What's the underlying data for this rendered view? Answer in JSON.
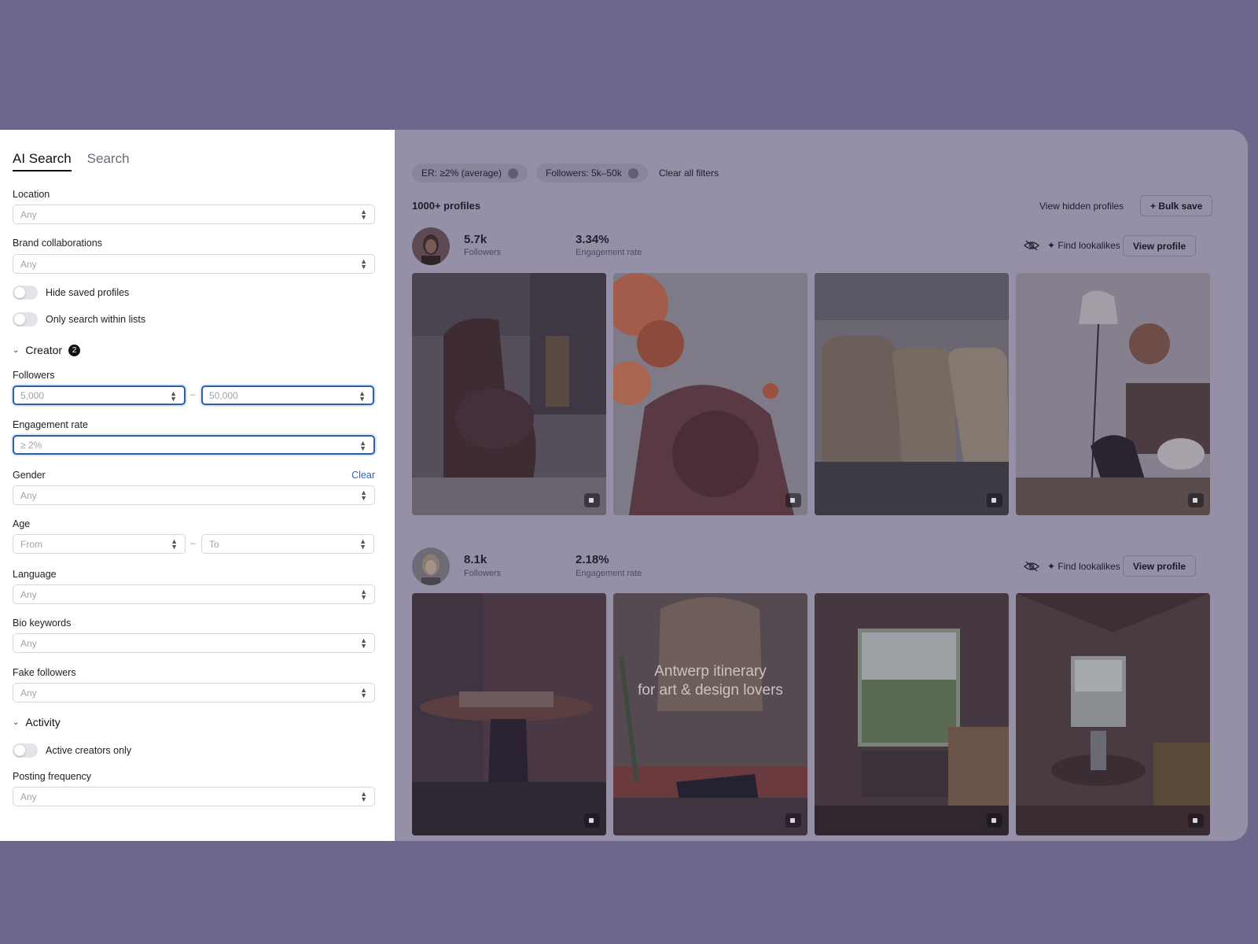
{
  "tabs": [
    {
      "label": "AI Search"
    },
    {
      "label": "Search"
    }
  ],
  "filters": {
    "location": {
      "label": "Location",
      "value": "Any"
    },
    "brand": {
      "label": "Brand collaborations",
      "value": "Any"
    },
    "hide_saved": "Hide saved profiles",
    "only_lists": "Only search within lists",
    "creator_section": {
      "label": "Creator",
      "badge": "2"
    },
    "followers": {
      "label": "Followers",
      "from": "5,000",
      "to": "50,000"
    },
    "engagement": {
      "label": "Engagement rate",
      "value": "≥ 2%"
    },
    "gender": {
      "label": "Gender",
      "value": "Any",
      "clear": "Clear"
    },
    "age": {
      "label": "Age",
      "from": "From",
      "to": "To"
    },
    "language": {
      "label": "Language",
      "value": "Any"
    },
    "bio": {
      "label": "Bio keywords",
      "value": "Any"
    },
    "fake": {
      "label": "Fake followers",
      "value": "Any"
    },
    "activity_section": {
      "label": "Activity"
    },
    "active_only": "Active creators only",
    "posting": {
      "label": "Posting frequency",
      "value": "Any"
    }
  },
  "results": {
    "chips": [
      "ER: ≥2% (average)",
      "Followers: 5k–50k"
    ],
    "clear_all": "Clear all filters",
    "count": "1000+ profiles",
    "view_hidden": "View hidden profiles",
    "bulk_save": "+ Bulk save",
    "profiles": [
      {
        "followers": "5.7k",
        "followers_label": "Followers",
        "er": "3.34%",
        "er_label": "Engagement rate",
        "lookalikes": "Find lookalikes",
        "view": "View profile"
      },
      {
        "followers": "8.1k",
        "followers_label": "Followers",
        "er": "2.18%",
        "er_label": "Engagement rate",
        "lookalikes": "Find lookalikes",
        "view": "View profile",
        "post_text": [
          "Antwerp itinerary",
          "for art & design lovers"
        ]
      }
    ]
  },
  "colors": {
    "backdrop": "#6f668e",
    "accent": "#2d63b6",
    "focus": "#2f5ea8"
  }
}
